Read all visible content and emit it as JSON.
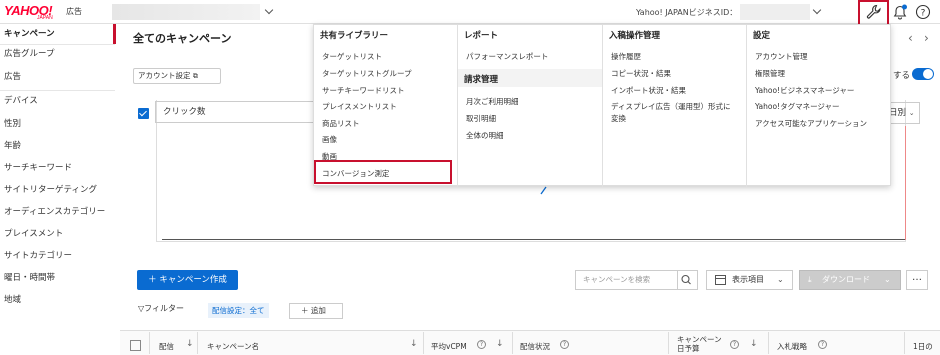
{
  "topbar": {
    "logo": "YAHOO!",
    "logo_sub": "JAPAN",
    "logo_ad": "広告",
    "bizid_label": "Yahoo! JAPANビジネスID："
  },
  "sidebar": {
    "items": [
      {
        "label": "キャンペーン",
        "active": true
      },
      {
        "label": "広告グループ"
      },
      {
        "label": "広告"
      },
      {
        "label": "デバイス"
      },
      {
        "label": "性別"
      },
      {
        "label": "年齢"
      },
      {
        "label": "サーチキーワード"
      },
      {
        "label": "サイトリターゲティング"
      },
      {
        "label": "オーディエンスカテゴリー"
      },
      {
        "label": "プレイスメント"
      },
      {
        "label": "サイトカテゴリー"
      },
      {
        "label": "曜日・時間帯"
      },
      {
        "label": "地域"
      }
    ]
  },
  "main": {
    "title": "全てのキャンペーン",
    "account_setting": "アカウント設定",
    "toggle_label": "する",
    "metric_select": "クリック数",
    "day_select": "日別",
    "create_button": "キャンペーン作成",
    "search_placeholder": "キャンペーンを検索",
    "display_items": "表示項目",
    "download": "ダウンロード",
    "more": "…",
    "filter_label": "フィルター",
    "filter_chip": "配信設定：全て",
    "add_label": "追加"
  },
  "table": {
    "headers": [
      "配信",
      "キャンペーン名",
      "平均vCPM",
      "配信状況",
      "キャンペーン日予算",
      "入札戦略",
      "1日の"
    ]
  },
  "menu": {
    "columns": [
      {
        "sections": [
          {
            "heading": "共有ライブラリー",
            "items": [
              "ターゲットリスト",
              "ターゲットリストグループ",
              "サーチキーワードリスト",
              "プレイスメントリスト",
              "商品リスト",
              "画像",
              "動画",
              "コンバージョン測定"
            ]
          }
        ]
      },
      {
        "sections": [
          {
            "heading": "レポート",
            "items": [
              "パフォーマンスレポート"
            ]
          },
          {
            "heading": "請求管理",
            "items": [
              "月次ご利用明細",
              "取引明細",
              "全体の明細"
            ]
          }
        ]
      },
      {
        "sections": [
          {
            "heading": "入稿操作管理",
            "items": [
              "操作履歴",
              "コピー状況・結果",
              "インポート状況・結果",
              "ディスプレイ広告（運用型）形式に",
              "変換"
            ]
          }
        ]
      },
      {
        "sections": [
          {
            "heading": "設定",
            "items": [
              "アカウント管理",
              "権限管理",
              "Yahoo!ビジネスマネージャー",
              "Yahoo!タグマネージャー",
              "アクセス可能なアプリケーション"
            ]
          }
        ]
      }
    ]
  },
  "colors": {
    "accent": "#0a6bd1",
    "highlight": "#c8102e",
    "brand": "#ff0033"
  }
}
